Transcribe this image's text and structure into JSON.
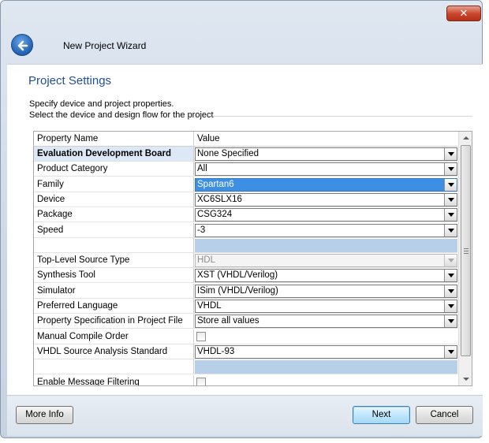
{
  "window": {
    "title": "New Project Wizard",
    "close_glyph": "✕"
  },
  "page": {
    "title": "Project Settings",
    "description_line1": "Specify device and project properties.",
    "description_line2": "Select the device and design flow for the project"
  },
  "table": {
    "header": {
      "name": "Property Name",
      "value": "Value"
    },
    "rows": [
      {
        "name": "Evaluation Development Board",
        "value": "None Specified",
        "control": "combo",
        "bold": true
      },
      {
        "name": "Product Category",
        "value": "All",
        "control": "combo"
      },
      {
        "name": "Family",
        "value": "Spartan6",
        "control": "combo-selected"
      },
      {
        "name": "Device",
        "value": "XC6SLX16",
        "control": "combo"
      },
      {
        "name": "Package",
        "value": "CSG324",
        "control": "combo"
      },
      {
        "name": "Speed",
        "value": "-3",
        "control": "combo"
      },
      {
        "name": "",
        "value": "",
        "control": "blank"
      },
      {
        "name": "Top-Level Source Type",
        "value": "HDL",
        "control": "combo-disabled"
      },
      {
        "name": "Synthesis Tool",
        "value": "XST (VHDL/Verilog)",
        "control": "combo"
      },
      {
        "name": "Simulator",
        "value": "ISim (VHDL/Verilog)",
        "control": "combo"
      },
      {
        "name": "Preferred Language",
        "value": "VHDL",
        "control": "combo"
      },
      {
        "name": "Property Specification in Project File",
        "value": "Store all values",
        "control": "combo"
      },
      {
        "name": "Manual Compile Order",
        "value": "",
        "control": "checkbox",
        "checked": false
      },
      {
        "name": "VHDL Source Analysis Standard",
        "value": "VHDL-93",
        "control": "combo"
      },
      {
        "name": "",
        "value": "",
        "control": "blank"
      },
      {
        "name": "Enable Message Filtering",
        "value": "",
        "control": "checkbox",
        "checked": false
      }
    ]
  },
  "buttons": {
    "more_info": "More Info",
    "next": "Next",
    "cancel": "Cancel"
  },
  "colors": {
    "accent": "#1f4f9b",
    "selection": "#3c8fe3",
    "blank_row": "#b7cfe9"
  },
  "icons": {
    "back": "back-arrow-icon",
    "close": "close-icon",
    "dropdown": "chevron-down-icon"
  }
}
